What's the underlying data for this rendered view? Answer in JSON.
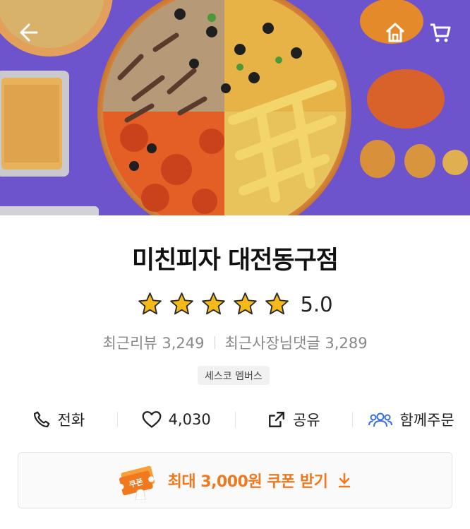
{
  "header": {
    "back_icon": "arrow-left-icon",
    "home_icon": "home-icon",
    "cart_icon": "cart-icon"
  },
  "store": {
    "name": "미친피자 대전동구점",
    "rating": "5.0",
    "stars": 5,
    "recent_reviews": "최근리뷰 3,249",
    "owner_comments": "최근사장님댓글 3,289",
    "badge": "세스코 멤버스"
  },
  "actions": {
    "call_label": "전화",
    "like_count": "4,030",
    "share_label": "공유",
    "group_order_label": "함께주문"
  },
  "coupon": {
    "ticket_label": "쿠폰",
    "label": "최대 3,000원 쿠폰 받기"
  },
  "colors": {
    "accent": "#f0781e",
    "star": "#f5b91a",
    "group_order_icon": "#3b6fe0"
  }
}
